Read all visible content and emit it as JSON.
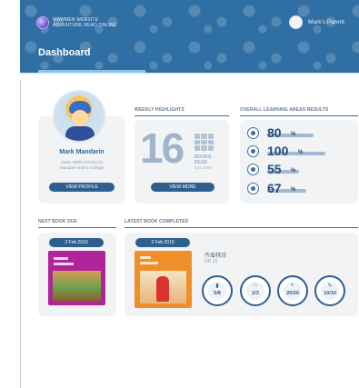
{
  "header": {
    "brand": "WAWMEN WEBSITE",
    "brand_sub": "ADVENTURE READ ONLINE",
    "user_name": "Mark's Parent",
    "page_title": "Dashboard"
  },
  "profile": {
    "name": "Mark Mandarin",
    "class_line": "Class NWM (Grrxxxl 5)",
    "school_line": "Mandarin Intera College",
    "button": "VIEW PROFILE"
  },
  "weekly": {
    "label": "WEEKLY HIGHLIGHTS",
    "count": "16",
    "unit_line1": "BOOKS",
    "unit_line2": "READ",
    "period": "last week",
    "button": "VIEW MORE"
  },
  "learning": {
    "label": "OVERALL LEARNING AREAS RESULTS",
    "areas": [
      {
        "icon": "reading-icon",
        "value": "80",
        "unit": "%",
        "fraction": 0.8
      },
      {
        "icon": "listening-icon",
        "value": "100",
        "unit": "%",
        "fraction": 1.0
      },
      {
        "icon": "speaking-icon",
        "value": "55",
        "unit": "%",
        "fraction": 0.55
      },
      {
        "icon": "writing-icon",
        "value": "67",
        "unit": "%",
        "fraction": 0.67
      }
    ]
  },
  "next_book": {
    "label": "NEXT BOOK DUE",
    "date": "2 Feb 2019"
  },
  "last_book": {
    "label": "LATEST BOOK COMPLETED",
    "date": "2 Feb 2019",
    "title": "齐眉桃诗",
    "level": "OR 21",
    "scores": [
      {
        "icon": "book-icon",
        "value": "5/8"
      },
      {
        "icon": "headphones-icon",
        "value": "2/3"
      },
      {
        "icon": "speaking-icon",
        "value": "20/20"
      },
      {
        "icon": "pencil-icon",
        "value": "10/10"
      }
    ]
  }
}
